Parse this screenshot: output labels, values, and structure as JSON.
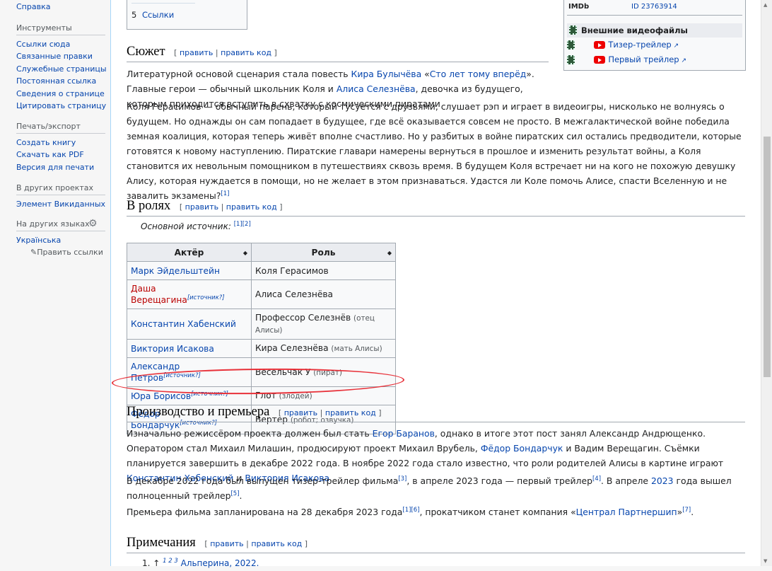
{
  "sidebar": {
    "top_link": "Справка",
    "tools": {
      "title": "Инструменты",
      "items": [
        "Ссылки сюда",
        "Связанные правки",
        "Служебные страницы",
        "Постоянная ссылка",
        "Сведения о странице",
        "Цитировать страницу"
      ]
    },
    "print": {
      "title": "Печать/экспорт",
      "items": [
        "Создать книгу",
        "Скачать как PDF",
        "Версия для печати"
      ]
    },
    "projects": {
      "title": "В других проектах",
      "items": [
        "Элемент Викиданных"
      ]
    },
    "languages": {
      "title": "На других языках",
      "icon": "gear-icon",
      "items": [
        "Українська"
      ],
      "edit_links": "Править ссылки"
    }
  },
  "toc": {
    "item_num": "5",
    "item_label": "Ссылки"
  },
  "infobox": {
    "imdb_label": "IMDb",
    "imdb_value": "ID 23763914",
    "videos_header": "Внешние видеофайлы",
    "videos": [
      "Тизер-трейлер",
      "Первый трейлер"
    ]
  },
  "edit": {
    "edit": "править",
    "edit_code": "править код",
    "sep": "|"
  },
  "plot": {
    "heading": "Сюжет",
    "p1": {
      "t1": "Литературной основой сценария стала повесть ",
      "l1": "Кира Булычёва",
      "t2": " «",
      "l2": "Сто лет тому вперёд",
      "t3": "». Главные герои — обычный школьник Коля и ",
      "l3": "Алиса Селезнёва",
      "t4": ", девочка из будущего, которым приходится вступить в схватку с космическими пиратами"
    },
    "p2": "Коля Герасимов — обычный парень, который тусуется с друзьями, слушает рэп и играет в видеоигры, нисколько не волнуясь о будущем. Но однажды он сам попадает в будущее, где всё оказывается совсем не просто. В межгалактической войне победила земная коалиция, которая теперь живёт вполне счастливо. Но у разбитых в войне пиратских сил остались предводители, которые готовятся к новому наступлению. Пиратские главари намерены вернуться в прошлое и изменить результат войны, а Коля становится их невольным помощником в путешествиях сквозь время. В будущем Коля встречает ни на кого не похожую девушку Алису, которая нуждается в помощи, но не желает в этом признаваться. Удастся ли Коле помочь Алисе, спасти Вселенную и не завалить экзамены?",
    "p2_ref": "[1]"
  },
  "cast": {
    "heading": "В ролях",
    "source_label": "Основной источник:",
    "source_refs": "[1][2]",
    "columns": [
      "Актёр",
      "Роль"
    ],
    "rows": [
      {
        "actor": "Марк Эйдельштейн",
        "actor_note": "",
        "role": "Коля Герасимов",
        "role_note": ""
      },
      {
        "actor": "Даша Верещагина",
        "actor_note": "[источник?]",
        "role": "Алиса Селезнёва",
        "role_note": ""
      },
      {
        "actor": "Константин Хабенский",
        "actor_note": "",
        "role": "Профессор Селезнёв",
        "role_note": "(отец Алисы)"
      },
      {
        "actor": "Виктория Исакова",
        "actor_note": "",
        "role": "Кира Селезнёва",
        "role_note": "(мать Алисы)"
      },
      {
        "actor": "Александр Петров",
        "actor_note": "[источник?]",
        "role": "Весельчак У",
        "role_note": "(пират)"
      },
      {
        "actor": "Юра Борисов",
        "actor_note": "[источник?]",
        "role": "Глот",
        "role_note": "(злодей)"
      },
      {
        "actor": "Фёдор Бондарчук",
        "actor_note": "[источник?]",
        "role": "Вертер",
        "role_note": "(робот; озвучка)"
      }
    ]
  },
  "production": {
    "heading": "Производство и премьера",
    "p1": {
      "t1": "Изначально режиссёром проекта должен был стать ",
      "l1": "Егор Баранов",
      "t2": ", однако в итоге этот пост занял Александр Андрющенко. Оператором стал Михаил Милашин, продюсируют проект Михаил Врубель, ",
      "l2": "Фёдор Бондарчук",
      "t3": " и Вадим Верещагин. Съёмки планируется завершить в декабре 2022 года. В ноябре 2022 года стало известно, что роли родителей Алисы в картине играют ",
      "l3": "Константин Хабенский",
      "t4": " и ",
      "l4": "Виктория Исакова",
      "t5": "."
    },
    "p2": {
      "t1": "В декабре 2022 года был выпущен тизер-трейлер фильма",
      "r1": "[3]",
      "t2": ", в апреле 2023 года — первый трейлер",
      "r2": "[4]",
      "t3": ". В апреле ",
      "l1": "2023",
      "t4": " года вышел полноценный трейлер",
      "r3": "[5]",
      "t5": "."
    },
    "p3": {
      "t1": "Премьера фильма запланирована на 28 декабря 2023 года",
      "r1": "[1][6]",
      "t2": ", прокатчиком станет компания «",
      "l1": "Централ Партнершип",
      "t3": "»",
      "r2": "[7]",
      "t4": "."
    }
  },
  "notes": {
    "heading": "Примечания",
    "first_item": "1. ↑ ",
    "first_refs": "1 2 3",
    "first_link": "Альперина, 2022."
  }
}
